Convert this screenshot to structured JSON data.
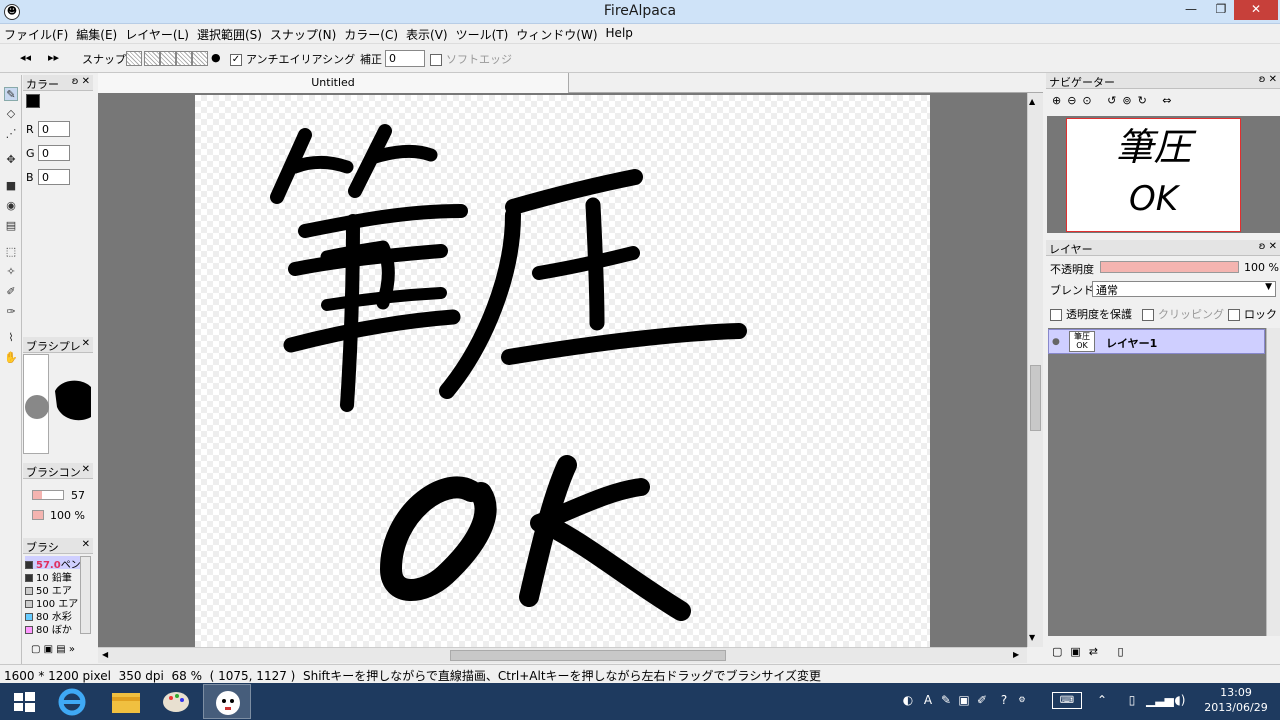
{
  "window": {
    "title": "FireAlpaca",
    "minimize": "—",
    "maximize": "❐",
    "close": "✕"
  },
  "menu": [
    "ファイル(F)",
    "編集(E)",
    "レイヤー(L)",
    "選択範囲(S)",
    "スナップ(N)",
    "カラー(C)",
    "表示(V)",
    "ツール(T)",
    "ウィンドウ(W)",
    "Help"
  ],
  "toolbar": {
    "snap_label": "スナップ",
    "antialias_label": "アンチエイリアシング",
    "antialias_checked": "✓",
    "correction_label": "補正",
    "correction_value": "0",
    "soft_edge_label": "ソフトエッジ"
  },
  "color_panel": {
    "title": "カラー",
    "r_label": "R",
    "r_value": "0",
    "g_label": "G",
    "g_value": "0",
    "b_label": "B",
    "b_value": "0"
  },
  "brush_preview": {
    "title": "ブラシプレ"
  },
  "brush_control": {
    "title": "ブラシコン",
    "size": "57",
    "opacity": "100 %"
  },
  "brush_list": {
    "title": "ブラシ",
    "items": [
      {
        "size": "57.0",
        "name": "ペン",
        "color": "#333333"
      },
      {
        "size": "10",
        "name": "鉛筆",
        "color": "#333333"
      },
      {
        "size": "50",
        "name": "エア",
        "color": "#cccccc"
      },
      {
        "size": "100",
        "name": "エア",
        "color": "#cccccc"
      },
      {
        "size": "80",
        "name": "水彩",
        "color": "#66ccff"
      },
      {
        "size": "80",
        "name": "ぼか",
        "color": "#ff99ff"
      }
    ]
  },
  "document": {
    "tab_title": "Untitled"
  },
  "navigator": {
    "title": "ナビゲーター",
    "preview_line1": "筆圧",
    "preview_line2": "OK"
  },
  "layers": {
    "title": "レイヤー",
    "opacity_label": "不透明度",
    "opacity_value": "100 %",
    "opacity_level": 1.0,
    "blend_label": "ブレンド",
    "blend_value": "通常",
    "protect_alpha": "透明度を保護",
    "clipping": "クリッピング",
    "lock": "ロック",
    "items": [
      {
        "name": "レイヤー1",
        "thumb_line1": "筆圧",
        "thumb_line2": "OK"
      }
    ]
  },
  "status": {
    "size": "1600 * 1200 pixel",
    "dpi": "350 dpi",
    "zoom": "68 %",
    "coords": "( 1075, 1127 )",
    "hint": "Shiftキーを押しながらで直線描画、Ctrl+Altキーを押しながら左右ドラッグでブラシサイズ変更"
  },
  "taskbar": {
    "time": "13:09",
    "date": "2013/06/29",
    "ime": "A"
  }
}
